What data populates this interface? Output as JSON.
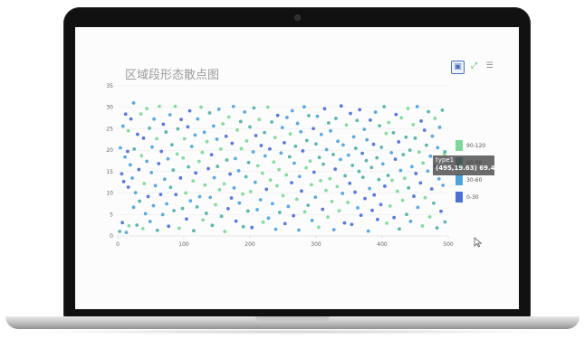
{
  "chart": {
    "title": "区域段形态散点图",
    "tooltip": {
      "series": "type1",
      "point": "(495,19.63)",
      "value": "69.4"
    }
  },
  "toolbox": {
    "save_icon": "save-image-icon",
    "fullscreen_icon": "fullscreen-icon",
    "menu_icon": "menu-icon"
  },
  "legend": [
    {
      "label": "90-120",
      "color": "#7ed898"
    },
    {
      "label": "60-90",
      "color": "#4fb0a5"
    },
    {
      "label": "30-60",
      "color": "#4fa3dd"
    },
    {
      "label": "0-30",
      "color": "#4c6fd6"
    }
  ],
  "chart_data": {
    "type": "scatter",
    "title": "区域段形态散点图",
    "xlim": [
      0,
      500
    ],
    "ylim": [
      0,
      35
    ],
    "xticks": [
      0,
      100,
      200,
      300,
      400,
      500
    ],
    "yticks": [
      0,
      5,
      10,
      15,
      20,
      25,
      30,
      35
    ],
    "grid": true,
    "legend_position": "right",
    "visual_map_ranges": [
      "90-120",
      "60-90",
      "30-60",
      "0-30"
    ],
    "points": [
      [
        3,
        1.05,
        82
      ],
      [
        4,
        20.55,
        34
      ],
      [
        6,
        14.49,
        20
      ],
      [
        7,
        3.1,
        13
      ],
      [
        8,
        25.6,
        37
      ],
      [
        9,
        12.67,
        27
      ],
      [
        11,
        18.42,
        45
      ],
      [
        12,
        28.41,
        5
      ],
      [
        13,
        0.82,
        49
      ],
      [
        15,
        19.71,
        29
      ],
      [
        16,
        24.52,
        100
      ],
      [
        16,
        11.38,
        28
      ],
      [
        17,
        2.37,
        94
      ],
      [
        19,
        16.59,
        37
      ],
      [
        20,
        27.27,
        29
      ],
      [
        22,
        13.49,
        34
      ],
      [
        24,
        6.68,
        47
      ],
      [
        24,
        31.01,
        36
      ],
      [
        25,
        20.27,
        83
      ],
      [
        27,
        10.1,
        46
      ],
      [
        29,
        2.52,
        61
      ],
      [
        30,
        23.7,
        23
      ],
      [
        32,
        15.5,
        19
      ],
      [
        33,
        8.1,
        66
      ],
      [
        35,
        28.44,
        104
      ],
      [
        36,
        18.7,
        104
      ],
      [
        38,
        1.71,
        104
      ],
      [
        39,
        22.81,
        3
      ],
      [
        40,
        12.19,
        103
      ],
      [
        42,
        5.2,
        55
      ],
      [
        44,
        29.7,
        103
      ],
      [
        44,
        17.41,
        41
      ],
      [
        46,
        9.2,
        15
      ],
      [
        48,
        25.13,
        85
      ],
      [
        49,
        3.37,
        57
      ],
      [
        51,
        14.78,
        34
      ],
      [
        52,
        20.73,
        34
      ],
      [
        54,
        7.05,
        55
      ],
      [
        55,
        27.26,
        47
      ],
      [
        57,
        11.74,
        36
      ],
      [
        59,
        22.68,
        100
      ],
      [
        60,
        1.31,
        84
      ],
      [
        62,
        16.87,
        23
      ],
      [
        63,
        30.22,
        116
      ],
      [
        65,
        9.68,
        14
      ],
      [
        66,
        19.71,
        24
      ],
      [
        68,
        4.97,
        59
      ],
      [
        69,
        26.06,
        11
      ],
      [
        71,
        13.22,
        34
      ],
      [
        73,
        24.23,
        63
      ],
      [
        74,
        7.48,
        30
      ],
      [
        76,
        17.97,
        56
      ],
      [
        77,
        2.26,
        17
      ],
      [
        79,
        28.26,
        38
      ],
      [
        80,
        11.34,
        78
      ],
      [
        82,
        21.27,
        66
      ],
      [
        84,
        15.36,
        83
      ],
      [
        85,
        5.91,
        69
      ],
      [
        87,
        30.23,
        111
      ],
      [
        88,
        9.64,
        16
      ],
      [
        90,
        19.11,
        105
      ],
      [
        91,
        24.96,
        80
      ],
      [
        93,
        1.78,
        90
      ],
      [
        95,
        13.53,
        10
      ],
      [
        96,
        27.16,
        11
      ],
      [
        98,
        6.41,
        62
      ],
      [
        99,
        18.18,
        114
      ],
      [
        101,
        22.66,
        104
      ],
      [
        103,
        10.02,
        102
      ],
      [
        104,
        3.95,
        21
      ],
      [
        106,
        25.46,
        15
      ],
      [
        107,
        16.11,
        87
      ],
      [
        109,
        29.18,
        9
      ],
      [
        110,
        8.18,
        32
      ],
      [
        112,
        20.87,
        50
      ],
      [
        114,
        12.84,
        104
      ],
      [
        115,
        1.22,
        65
      ],
      [
        117,
        23.53,
        54
      ],
      [
        118,
        14.69,
        11
      ],
      [
        120,
        6.77,
        60
      ],
      [
        121,
        27.28,
        42
      ],
      [
        123,
        17.38,
        103
      ],
      [
        124,
        9.16,
        36
      ],
      [
        126,
        30.03,
        115
      ],
      [
        128,
        19.48,
        104
      ],
      [
        129,
        3.74,
        113
      ],
      [
        131,
        24.18,
        55
      ],
      [
        132,
        11.87,
        113
      ],
      [
        134,
        5.28,
        79
      ],
      [
        135,
        21.99,
        115
      ],
      [
        137,
        15.7,
        20
      ],
      [
        139,
        28.69,
        68
      ],
      [
        140,
        8.99,
        43
      ],
      [
        142,
        18.94,
        24
      ],
      [
        143,
        2.46,
        74
      ],
      [
        145,
        25.64,
        30
      ],
      [
        146,
        13.58,
        44
      ],
      [
        148,
        7.27,
        103
      ],
      [
        150,
        22.55,
        54
      ],
      [
        151,
        16.22,
        87
      ],
      [
        153,
        29.55,
        38
      ],
      [
        154,
        10.77,
        96
      ],
      [
        156,
        20.26,
        91
      ],
      [
        157,
        4.59,
        68
      ],
      [
        159,
        26.14,
        115
      ],
      [
        161,
        12.15,
        110
      ],
      [
        162,
        1.04,
        103
      ],
      [
        164,
        23.24,
        5
      ],
      [
        165,
        17.71,
        81
      ],
      [
        167,
        6.34,
        24
      ],
      [
        168,
        27.73,
        102
      ],
      [
        170,
        14.43,
        25
      ],
      [
        172,
        8.85,
        6
      ],
      [
        173,
        21.61,
        26
      ],
      [
        175,
        30.21,
        33
      ],
      [
        176,
        11.19,
        55
      ],
      [
        178,
        18.06,
        41
      ],
      [
        179,
        3.45,
        22
      ],
      [
        181,
        24.71,
        115
      ],
      [
        183,
        15.21,
        41
      ],
      [
        184,
        7.68,
        42
      ],
      [
        186,
        26.68,
        75
      ],
      [
        187,
        20.36,
        92
      ],
      [
        189,
        9.77,
        103
      ],
      [
        190,
        2.16,
        77
      ],
      [
        192,
        28.92,
        46
      ],
      [
        194,
        13.8,
        67
      ],
      [
        195,
        22.16,
        99
      ],
      [
        197,
        5.81,
        71
      ],
      [
        198,
        17.12,
        63
      ],
      [
        200,
        25.44,
        80
      ],
      [
        201,
        10.35,
        111
      ],
      [
        203,
        1.96,
        23
      ],
      [
        205,
        19.61,
        35
      ],
      [
        206,
        29.86,
        65
      ],
      [
        208,
        12.51,
        48
      ],
      [
        209,
        23.4,
        11
      ],
      [
        211,
        6.11,
        50
      ],
      [
        212,
        16.36,
        95
      ],
      [
        214,
        27.15,
        119
      ],
      [
        216,
        8.43,
        56
      ],
      [
        217,
        21.08,
        9
      ],
      [
        219,
        14.62,
        117
      ],
      [
        220,
        3.2,
        111
      ],
      [
        222,
        24.11,
        65
      ],
      [
        223,
        18.66,
        58
      ],
      [
        225,
        10.89,
        12
      ],
      [
        227,
        30.04,
        97
      ],
      [
        228,
        4.16,
        47
      ],
      [
        230,
        20.29,
        2
      ],
      [
        231,
        13.03,
        90
      ],
      [
        233,
        26.57,
        85
      ],
      [
        234,
        7.53,
        54
      ],
      [
        236,
        17.23,
        108
      ],
      [
        238,
        22.96,
        98
      ],
      [
        239,
        1.56,
        34
      ],
      [
        241,
        11.7,
        102
      ],
      [
        242,
        28.11,
        20
      ],
      [
        244,
        15.49,
        114
      ],
      [
        245,
        5.49,
        61
      ],
      [
        247,
        19.34,
        30
      ],
      [
        249,
        25.27,
        44
      ],
      [
        250,
        9.4,
        108
      ],
      [
        252,
        21.75,
        7
      ],
      [
        253,
        2.87,
        22
      ],
      [
        255,
        14.22,
        103
      ],
      [
        256,
        27.63,
        46
      ],
      [
        258,
        6.89,
        52
      ],
      [
        260,
        18.46,
        60
      ],
      [
        261,
        23.8,
        116
      ],
      [
        263,
        12.42,
        4
      ],
      [
        264,
        29.21,
        53
      ],
      [
        266,
        4.71,
        6
      ],
      [
        267,
        16.98,
        56
      ],
      [
        269,
        20.92,
        73
      ],
      [
        271,
        8.56,
        95
      ],
      [
        272,
        26.24,
        31
      ],
      [
        274,
        1.37,
        52
      ],
      [
        275,
        13.87,
        46
      ],
      [
        277,
        24.3,
        50
      ],
      [
        278,
        10.48,
        16
      ],
      [
        280,
        19.83,
        18
      ],
      [
        282,
        30.11,
        41
      ],
      [
        283,
        5.63,
        117
      ],
      [
        285,
        15.89,
        98
      ],
      [
        286,
        22.27,
        86
      ],
      [
        288,
        7.14,
        87
      ],
      [
        289,
        28.07,
        75
      ],
      [
        291,
        17.46,
        111
      ],
      [
        293,
        11.94,
        106
      ],
      [
        294,
        3.6,
        30
      ],
      [
        296,
        25.04,
        4
      ],
      [
        297,
        14.86,
        21
      ],
      [
        299,
        9.03,
        38
      ],
      [
        300,
        21.45,
        76
      ],
      [
        302,
        27.9,
        41
      ],
      [
        304,
        2.03,
        91
      ],
      [
        305,
        18.3,
        80
      ],
      [
        307,
        12.88,
        119
      ],
      [
        308,
        23.66,
        37
      ],
      [
        310,
        6.22,
        15
      ],
      [
        311,
        16.74,
        75
      ],
      [
        313,
        29.68,
        18
      ],
      [
        315,
        10.62,
        111
      ],
      [
        316,
        20.14,
        49
      ],
      [
        318,
        4.39,
        105
      ],
      [
        319,
        26.36,
        89
      ],
      [
        321,
        13.36,
        109
      ],
      [
        322,
        24.5,
        42
      ],
      [
        324,
        8.03,
        105
      ],
      [
        326,
        19.01,
        65
      ],
      [
        327,
        1.45,
        37
      ],
      [
        329,
        15.57,
        5
      ],
      [
        330,
        27.41,
        80
      ],
      [
        332,
        11.52,
        102
      ],
      [
        333,
        22.09,
        43
      ],
      [
        335,
        5.86,
        101
      ],
      [
        337,
        17.84,
        42
      ],
      [
        338,
        30.32,
        10
      ],
      [
        340,
        9.92,
        41
      ],
      [
        341,
        21.21,
        43
      ],
      [
        343,
        3.03,
        21
      ],
      [
        344,
        14.03,
        72
      ],
      [
        346,
        25.87,
        115
      ],
      [
        348,
        7.81,
        108
      ],
      [
        349,
        18.85,
        51
      ],
      [
        351,
        12.27,
        7
      ],
      [
        352,
        28.57,
        4
      ],
      [
        354,
        2.69,
        19
      ],
      [
        355,
        16.45,
        71
      ],
      [
        357,
        23.11,
        30
      ],
      [
        359,
        10.21,
        24
      ],
      [
        360,
        20.44,
        80
      ],
      [
        362,
        26.93,
        68
      ],
      [
        363,
        6.55,
        39
      ],
      [
        365,
        15.06,
        68
      ],
      [
        366,
        29.44,
        4
      ],
      [
        368,
        4.82,
        22
      ],
      [
        370,
        19.27,
        15
      ],
      [
        371,
        13.68,
        62
      ],
      [
        373,
        24.85,
        32
      ],
      [
        374,
        8.72,
        2
      ],
      [
        376,
        17.57,
        89
      ],
      [
        377,
        22.42,
        39
      ],
      [
        379,
        1.14,
        34
      ],
      [
        381,
        11.06,
        40
      ],
      [
        382,
        27.01,
        17
      ],
      [
        384,
        15.96,
        64
      ],
      [
        385,
        5.97,
        23
      ],
      [
        387,
        21.38,
        5
      ],
      [
        388,
        9.55,
        28
      ],
      [
        390,
        28.87,
        46
      ],
      [
        392,
        18.22,
        62
      ],
      [
        393,
        3.84,
        13
      ],
      [
        395,
        13.14,
        62
      ],
      [
        396,
        25.69,
        71
      ],
      [
        398,
        7.33,
        21
      ],
      [
        399,
        20.66,
        60
      ],
      [
        401,
        16.82,
        55
      ],
      [
        403,
        30.15,
        75
      ],
      [
        404,
        11.61,
        4
      ],
      [
        406,
        23.89,
        105
      ],
      [
        407,
        2.97,
        113
      ],
      [
        409,
        14.11,
        88
      ],
      [
        410,
        26.46,
        97
      ],
      [
        412,
        6.98,
        102
      ],
      [
        414,
        19.42,
        40
      ],
      [
        415,
        12.98,
        107
      ],
      [
        417,
        24.07,
        62
      ],
      [
        418,
        4.28,
        27
      ],
      [
        420,
        17.89,
        19
      ],
      [
        421,
        28.33,
        25
      ],
      [
        423,
        10.44,
        116
      ],
      [
        425,
        21.94,
        26
      ],
      [
        426,
        1.62,
        72
      ],
      [
        428,
        15.27,
        45
      ],
      [
        429,
        27.55,
        90
      ],
      [
        431,
        8.31,
        93
      ],
      [
        432,
        18.97,
        62
      ],
      [
        434,
        13.45,
        104
      ],
      [
        436,
        23.03,
        60
      ],
      [
        437,
        5.02,
        82
      ],
      [
        439,
        29.72,
        110
      ],
      [
        440,
        11.21,
        66
      ],
      [
        442,
        20.01,
        66
      ],
      [
        443,
        3.41,
        49
      ],
      [
        445,
        16.16,
        44
      ],
      [
        447,
        25.95,
        94
      ],
      [
        448,
        9.26,
        15
      ],
      [
        450,
        22.81,
        70
      ],
      [
        451,
        14.56,
        28
      ],
      [
        453,
        30.18,
        39
      ],
      [
        454,
        6.66,
        51
      ],
      [
        456,
        19.56,
        114
      ],
      [
        458,
        12.36,
        20
      ],
      [
        459,
        26.81,
        8
      ],
      [
        461,
        2.33,
        95
      ],
      [
        462,
        17.01,
        118
      ],
      [
        464,
        24.66,
        6
      ],
      [
        465,
        8.92,
        118
      ],
      [
        467,
        21.17,
        70
      ],
      [
        469,
        15.13,
        43
      ],
      [
        470,
        28.98,
        75
      ],
      [
        472,
        4.46,
        93
      ],
      [
        473,
        18.59,
        33
      ],
      [
        475,
        10.96,
        11
      ],
      [
        476,
        23.28,
        41
      ],
      [
        478,
        7.65,
        87
      ],
      [
        480,
        27.44,
        108
      ],
      [
        481,
        16.31,
        22
      ],
      [
        483,
        1.88,
        82
      ],
      [
        484,
        20.58,
        33
      ],
      [
        486,
        13.31,
        53
      ],
      [
        487,
        25.34,
        56
      ],
      [
        489,
        5.74,
        21
      ],
      [
        491,
        29.33,
        62
      ],
      [
        492,
        11.81,
        47
      ],
      [
        494,
        19.07,
        100
      ],
      [
        495,
        3.27,
        70
      ],
      [
        495,
        19.63,
        69.4
      ]
    ]
  }
}
